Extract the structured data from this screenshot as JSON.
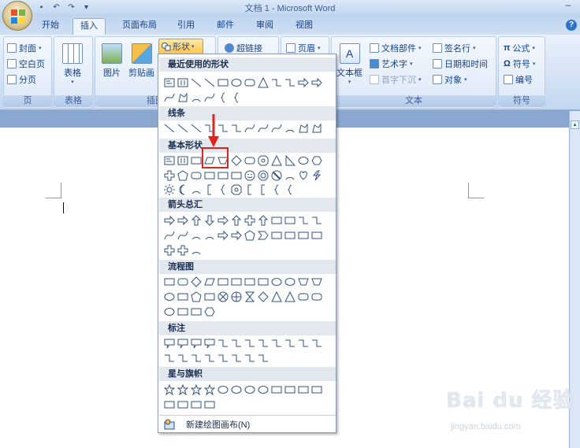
{
  "window": {
    "title": "文档 1 - Microsoft Word",
    "minimize_glyph": "–"
  },
  "qat": [
    {
      "name": "save",
      "glyph": "▪"
    },
    {
      "name": "undo",
      "glyph": "↶"
    },
    {
      "name": "redo",
      "glyph": "↷"
    },
    {
      "name": "customize",
      "glyph": "▾"
    }
  ],
  "tabs": [
    {
      "label": "开始",
      "active": false
    },
    {
      "label": "插入",
      "active": true
    },
    {
      "label": "页面布局",
      "active": false
    },
    {
      "label": "引用",
      "active": false
    },
    {
      "label": "邮件",
      "active": false
    },
    {
      "label": "审阅",
      "active": false
    },
    {
      "label": "视图",
      "active": false
    }
  ],
  "help_glyph": "?",
  "ribbon": {
    "pages": {
      "label": "页",
      "cover": "封面",
      "blank": "空白页",
      "break": "分页"
    },
    "tables": {
      "label": "表格",
      "table": "表格"
    },
    "illustrations": {
      "label": "插图",
      "picture": "图片",
      "clipart": "剪贴画",
      "shapes": "形状"
    },
    "links": {
      "hyperlink": "超链接"
    },
    "header_footer": {
      "header": "页眉"
    },
    "text": {
      "label": "文本",
      "textbox": "文本框",
      "quickparts": "文档部件",
      "wordart": "艺术字",
      "dropcap": "首字下沉",
      "signature": "签名行",
      "datetime": "日期和时间",
      "object": "对象"
    },
    "symbols": {
      "label": "符号",
      "equation": "公式",
      "symbol": "符号",
      "number": "编号"
    }
  },
  "gallery": {
    "categories": [
      {
        "key": "recent",
        "label": "最近使用的形状"
      },
      {
        "key": "lines",
        "label": "线条"
      },
      {
        "key": "basic",
        "label": "基本形状"
      },
      {
        "key": "arrows",
        "label": "箭头总汇"
      },
      {
        "key": "flowchart",
        "label": "流程图"
      },
      {
        "key": "callouts",
        "label": "标注"
      },
      {
        "key": "stars",
        "label": "星与旗帜"
      }
    ],
    "rows": {
      "recent": [
        [
          "textbox",
          "vtextbox",
          "line",
          "line",
          "rect",
          "oval",
          "roundrect",
          "triangle",
          "elbow",
          "elbow",
          "arrow",
          "arrow"
        ],
        [
          "curve",
          "freeform",
          "arc",
          "curve",
          "brace",
          "brace"
        ]
      ],
      "lines": [
        [
          "line",
          "line",
          "line",
          "elbow",
          "elbow",
          "elbow",
          "curve",
          "curve",
          "curve",
          "arc",
          "freeform",
          "freeform"
        ]
      ],
      "basic": [
        [
          "textbox",
          "vtextbox",
          "rect",
          "parallelogram",
          "trapezoid",
          "diamond",
          "roundrect",
          "octagon",
          "triangle",
          "rtriangle",
          "oval",
          "hexagon"
        ],
        [
          "plus",
          "pentagon",
          "roundrect",
          "rect",
          "rect",
          "rect",
          "smiley",
          "donut",
          "nosymbol",
          "arc",
          "heart",
          "lightning"
        ],
        [
          "sun",
          "moon",
          "arc",
          "bracket",
          "brace",
          "octagon",
          "bracket",
          "bracket",
          "brace",
          "brace"
        ]
      ],
      "arrows": [
        [
          "arrow",
          "arrow",
          "uparrow",
          "downarrow",
          "arrow",
          "uparrow",
          "plus",
          "uparrow",
          "rect",
          "rect",
          "elbow",
          "elbow"
        ],
        [
          "curve",
          "curve",
          "arc",
          "arc",
          "arrow",
          "arrow",
          "pentagon",
          "chevron",
          "rect",
          "rect",
          "rect",
          "rect"
        ],
        [
          "plus",
          "plus",
          "arc"
        ]
      ],
      "flowchart": [
        [
          "rect",
          "roundrect",
          "diamond",
          "parallelogram",
          "rect",
          "rect",
          "rect",
          "rect",
          "oval",
          "oval",
          "trapezoid",
          "trapezoid"
        ],
        [
          "oval",
          "rect",
          "pentagon",
          "rect",
          "xcircle",
          "pluscircle",
          "hourglass",
          "diamond",
          "triangle",
          "triangle",
          "roundrect",
          "roundrect"
        ],
        [
          "oval",
          "rect",
          "rect",
          "hexagon"
        ]
      ],
      "callouts": [
        [
          "callout",
          "callout",
          "callout",
          "callout",
          "elbow",
          "elbow",
          "elbow",
          "elbow",
          "elbow",
          "elbow",
          "elbow",
          "elbow"
        ],
        [
          "elbow",
          "elbow",
          "elbow",
          "elbow",
          "elbow",
          "elbow",
          "elbow",
          "elbow"
        ]
      ],
      "stars": [
        [
          "star",
          "star",
          "star",
          "star",
          "oval",
          "oval",
          "oval",
          "oval",
          "rect",
          "rect",
          "rect",
          "rect"
        ],
        [
          "rect",
          "rect",
          "rect",
          "rect"
        ]
      ]
    },
    "new_canvas_label": "新建绘图画布(N)"
  },
  "watermark": {
    "brand": "Bai du 经验",
    "url": "jingyan.baidu.com"
  },
  "colors": {
    "accent": "#e0231c",
    "ribbon_text": "#15428b",
    "shape_stroke": "#31527c"
  }
}
